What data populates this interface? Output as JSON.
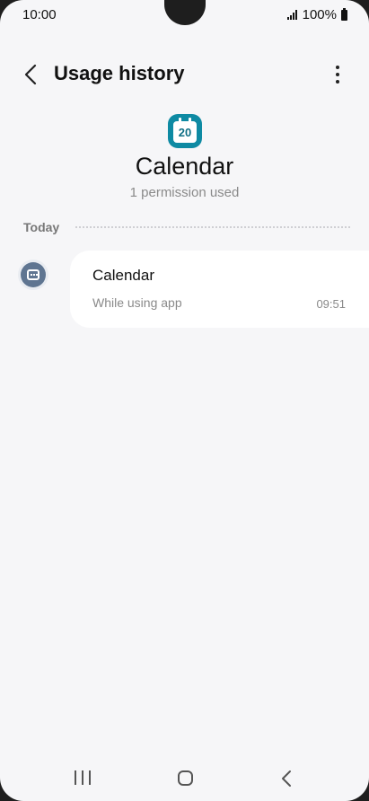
{
  "status_bar": {
    "time": "10:00",
    "battery": "100%",
    "icons": [
      "signal-icon",
      "battery-icon"
    ]
  },
  "app_bar": {
    "title": "Usage history",
    "back_icon": "chevron-left-icon",
    "more_icon": "more-vertical-icon"
  },
  "app": {
    "icon_label": "20",
    "name": "Calendar",
    "permission_count": "1 permission used",
    "icon_color": "#0e8aa3"
  },
  "section": {
    "label": "Today"
  },
  "entries": [
    {
      "icon": "calendar-permission-icon",
      "title": "Calendar",
      "subtitle": "While using app",
      "time": "09:51"
    }
  ],
  "nav_bar": {
    "items": [
      "recent-apps-icon",
      "home-icon",
      "back-icon"
    ]
  },
  "colors": {
    "background": "#f6f6f8",
    "card": "#ffffff",
    "permission_icon": "#5f7591"
  }
}
